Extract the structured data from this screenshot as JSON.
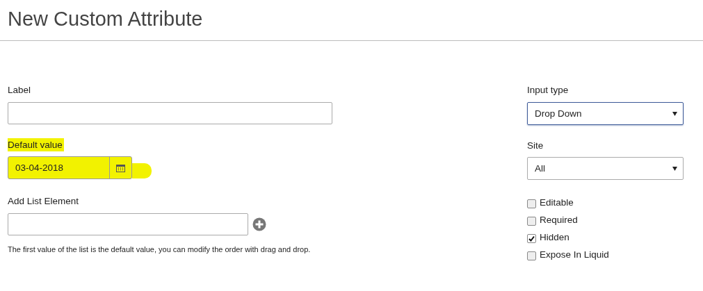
{
  "title": "New Custom Attribute",
  "label_field": {
    "label": "Label"
  },
  "default_value": {
    "label": "Default value",
    "value": "03-04-2018",
    "highlighted": true
  },
  "list_element": {
    "label": "Add List Element",
    "help": "The first value of the list is the default value, you can modify the order with drag and drop."
  },
  "input_type": {
    "label": "Input type",
    "value": "Drop Down",
    "focused": true
  },
  "site": {
    "label": "Site",
    "value": "All",
    "focused": false
  },
  "options": [
    {
      "label": "Editable",
      "checked": false
    },
    {
      "label": "Required",
      "checked": false
    },
    {
      "label": "Hidden",
      "checked": true
    },
    {
      "label": "Expose In Liquid",
      "checked": false
    }
  ]
}
